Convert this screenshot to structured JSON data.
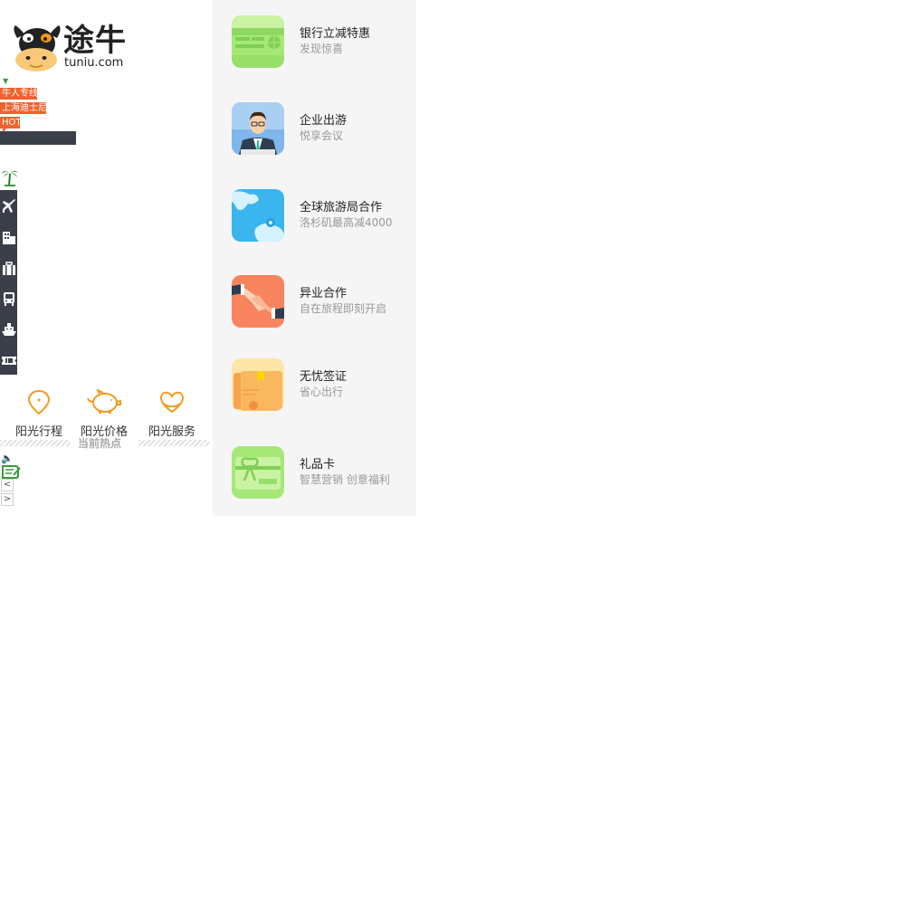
{
  "logo": {
    "brand_cn": "途牛",
    "brand_en": "tuniu.com"
  },
  "tags": [
    {
      "label": "牛人专线"
    },
    {
      "label": "上海迪士尼"
    },
    {
      "label": "HOT"
    }
  ],
  "side_nav": {
    "items": [
      {
        "icon": "palm-tree-icon"
      },
      {
        "icon": "airplane-icon"
      },
      {
        "icon": "hotel-icon"
      },
      {
        "icon": "luggage-icon"
      },
      {
        "icon": "bus-icon"
      },
      {
        "icon": "cruise-ship-icon"
      },
      {
        "icon": "ticket-icon"
      }
    ]
  },
  "promises": [
    {
      "label": "阳光行程",
      "icon": "location-pin-icon"
    },
    {
      "label": "阳光价格",
      "icon": "piggy-bank-icon"
    },
    {
      "label": "阳光服务",
      "icon": "heart-hands-icon"
    }
  ],
  "hot": {
    "title": "当前热点"
  },
  "colors": {
    "accent": "#f0612e",
    "nav_bg": "#3b3f4a",
    "promise_orange": "#f39a1e",
    "panel_bg": "#f5f5f5"
  },
  "cooperate": {
    "items": [
      {
        "title": "银行立减特惠",
        "subtitle": "发现惊喜",
        "icon": "bank-card-icon"
      },
      {
        "title": "企业出游",
        "subtitle": "悦享会议",
        "icon": "businessman-icon"
      },
      {
        "title": "全球旅游局合作",
        "subtitle": "洛杉矶最高减4000",
        "icon": "world-map-icon"
      },
      {
        "title": "异业合作",
        "subtitle": "自在旅程即刻开启",
        "icon": "handshake-icon"
      },
      {
        "title": "无忧签证",
        "subtitle": "省心出行",
        "icon": "visa-document-icon"
      },
      {
        "title": "礼品卡",
        "subtitle": "智慧营销 创意福利",
        "icon": "gift-card-icon"
      }
    ]
  }
}
